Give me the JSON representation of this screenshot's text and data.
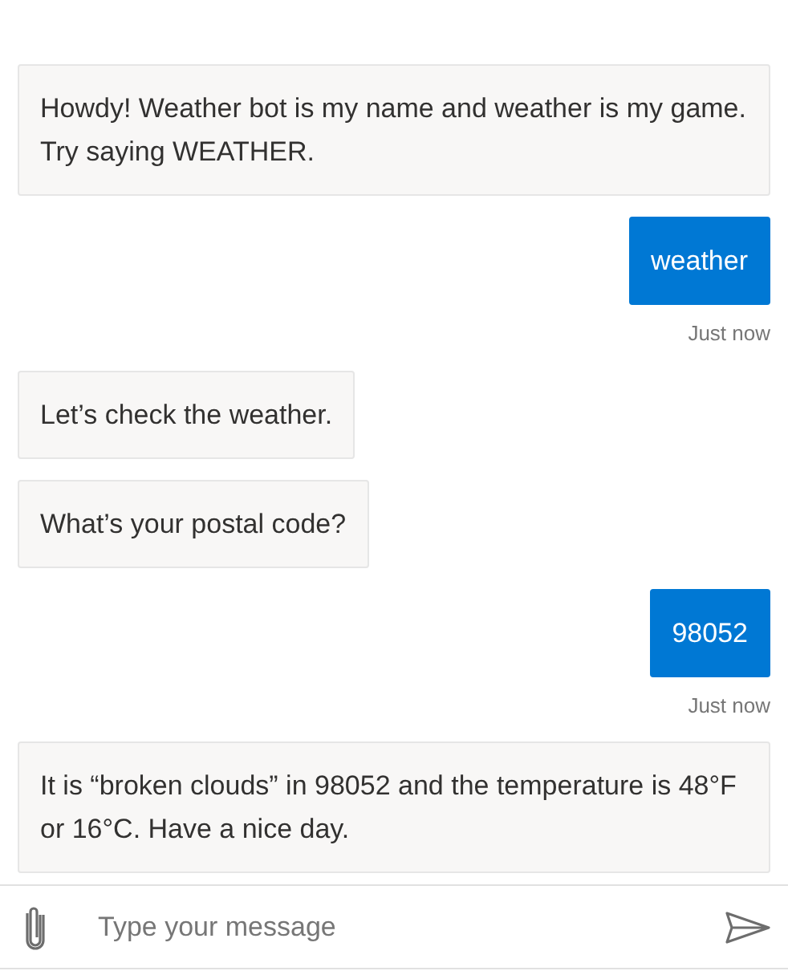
{
  "messages": [
    {
      "kind": "bot",
      "text": "Howdy! Weather bot is my name and weather is my game. Try saying WEATHER."
    },
    {
      "kind": "user",
      "text": "weather",
      "timestamp": "Just now"
    },
    {
      "kind": "bot",
      "text": "Let’s check the weather."
    },
    {
      "kind": "bot",
      "text": "What’s your postal code?"
    },
    {
      "kind": "user",
      "text": "98052",
      "timestamp": "Just now"
    },
    {
      "kind": "bot",
      "text": "It is “broken clouds” in 98052 and the temperature is 48°F or 16°C. Have a nice day."
    }
  ],
  "composer": {
    "placeholder": "Type your message"
  }
}
